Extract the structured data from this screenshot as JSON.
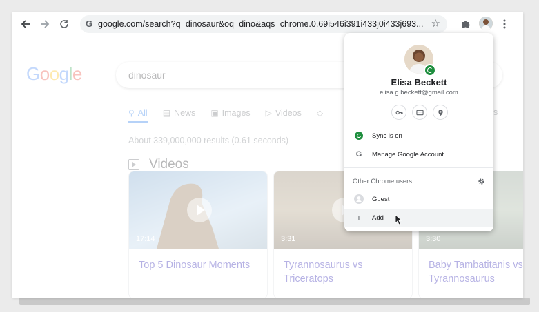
{
  "toolbar": {
    "url": "google.com/search?q=dinosaur&oq=dino&aqs=chrome.0.69i546i391i433j0i433j693...",
    "site_icon_letter": "G",
    "icons": [
      "back-arrow-icon",
      "forward-arrow-icon",
      "reload-icon",
      "star-icon",
      "puzzle-icon",
      "kebab-menu-icon"
    ]
  },
  "page": {
    "logo": [
      "G",
      "o",
      "o",
      "g",
      "l",
      "e"
    ],
    "logo_colors": [
      "#4285f4",
      "#ea4335",
      "#fbbc05",
      "#4285f4",
      "#34a853",
      "#ea4335"
    ],
    "search_query": "dinosaur",
    "tabs": [
      {
        "label": "All",
        "icon": "search-icon"
      },
      {
        "label": "News",
        "icon": "news-icon"
      },
      {
        "label": "Images",
        "icon": "image-icon"
      },
      {
        "label": "Videos",
        "icon": "video-icon"
      }
    ],
    "tools_label": "gs",
    "results_count": "About 339,000,000 results (0.61 seconds)",
    "videos_heading": "Videos",
    "cards": [
      {
        "duration": "17:14",
        "title": "Top 5 Dinosaur Moments"
      },
      {
        "duration": "3:31",
        "title": "Tyrannosaurus vs Triceratops"
      },
      {
        "duration": "3:30",
        "title": "Baby Tambatitanis vs Tyrannosaurus"
      }
    ]
  },
  "profile_menu": {
    "name": "Elisa Beckett",
    "email": "elisa.g.beckett@gmail.com",
    "quick_icons": [
      "key-icon",
      "card-icon",
      "location-pin-icon"
    ],
    "sync_label": "Sync is on",
    "manage_label": "Manage Google Account",
    "other_users_label": "Other Chrome users",
    "guest_label": "Guest",
    "add_label": "Add",
    "accent_green": "#1e8e3e"
  }
}
